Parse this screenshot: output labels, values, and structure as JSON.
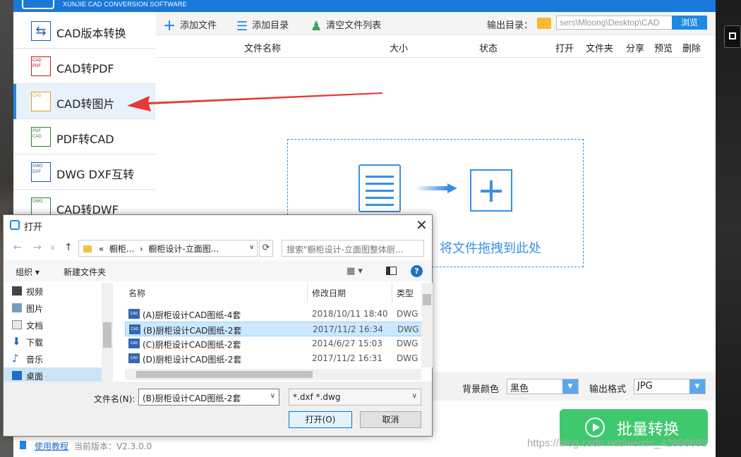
{
  "app": {
    "brand": "XUNJIE CAD CONVERSION SOFTWARE",
    "sidebar": [
      {
        "label": "CAD版本转换",
        "icon": "cad-version-icon"
      },
      {
        "label": "CAD转PDF",
        "icon": "cad-pdf-icon"
      },
      {
        "label": "CAD转图片",
        "icon": "cad-image-icon",
        "active": true
      },
      {
        "label": "PDF转CAD",
        "icon": "pdf-cad-icon"
      },
      {
        "label": "DWG DXF互转",
        "icon": "dwg-dxf-icon"
      },
      {
        "label": "CAD转DWF",
        "icon": "cad-dwf-icon"
      }
    ],
    "sidebar_icon_text": [
      "",
      "CAD\nPDF",
      "CAD",
      "PDF\nCAD",
      "DWG\nDXF",
      "DWG"
    ],
    "toolbar": {
      "add_file": "添加文件",
      "add_dir": "添加目录",
      "clear_list": "清空文件列表",
      "output_label": "输出目录：",
      "output_path": "sers\\Mloong\\Desktop\\CAD",
      "browse": "浏览"
    },
    "table_headers": {
      "name": "文件名称",
      "size": "大小",
      "status": "状态",
      "open": "打开",
      "folder": "文件夹",
      "share": "分享",
      "preview": "预览",
      "delete": "删除"
    },
    "drop_text": "将文件拖拽到此处",
    "options": {
      "bg_label": "背景颜色",
      "bg_value": "黑色",
      "format_label": "输出格式",
      "format_value": "JPG"
    },
    "batch_button": "批量转换",
    "help_link": "使用教程",
    "version": "当前版本：V2.3.0.0",
    "watermark": "https://blog.csdn.net/weixin_42896692"
  },
  "dialog": {
    "title": "打开",
    "breadcrumb": [
      "«",
      "橱柜...",
      "›",
      "橱柜设计-立面图..."
    ],
    "search_placeholder": "搜索\"橱柜设计-立面图整体厨...",
    "organize": "组织 ▾",
    "new_folder": "新建文件夹",
    "nav_items": [
      "视频",
      "图片",
      "文档",
      "下载",
      "音乐",
      "桌面"
    ],
    "columns": {
      "name": "名称",
      "date": "修改日期",
      "type": "类型"
    },
    "files": [
      {
        "name": "(A)厨柜设计CAD图纸-4套",
        "date": "2018/10/11 18:40",
        "type": "DWG"
      },
      {
        "name": "(B)厨柜设计CAD图纸-2套",
        "date": "2017/11/2 16:34",
        "type": "DWG",
        "selected": true
      },
      {
        "name": "(C)厨柜设计CAD图纸-2套",
        "date": "2014/6/27 15:03",
        "type": "DWG"
      },
      {
        "name": "(D)厨柜设计CAD图纸-2套",
        "date": "2017/11/2 16:31",
        "type": "DWG"
      }
    ],
    "file_icon_text": "CAD",
    "filename_label": "文件名(N):",
    "filename_value": "(B)厨柜设计CAD图纸-2套",
    "filetype_value": "*.dxf *.dwg",
    "open_button": "打开(O)",
    "cancel_button": "取消"
  },
  "colors": {
    "accent": "#1e88e5",
    "batch": "#3fc96f",
    "arrow": "#e53935"
  }
}
